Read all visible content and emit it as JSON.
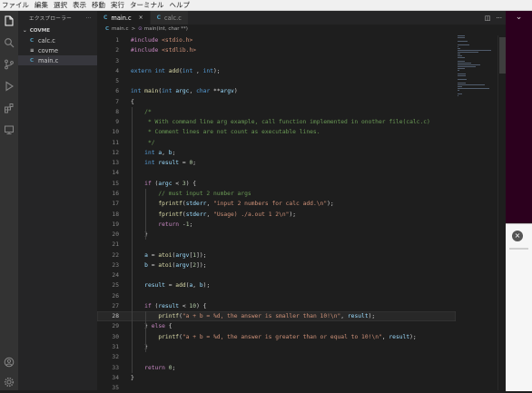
{
  "menubar": {
    "items": [
      "ファイル",
      "編集",
      "選択",
      "表示",
      "移動",
      "実行",
      "ターミナル",
      "ヘルプ"
    ]
  },
  "activity_bar": {
    "icons": [
      "files-icon",
      "search-icon",
      "source-control-icon",
      "run-debug-icon",
      "extensions-icon",
      "remote-explorer-icon",
      "account-icon",
      "settings-gear-icon"
    ]
  },
  "sidebar": {
    "title": "エクスプローラー",
    "more": "···",
    "folder": "COVME",
    "files": [
      {
        "icon": "C",
        "name": "calc.c"
      },
      {
        "icon": "≡",
        "name": "covme"
      },
      {
        "icon": "C",
        "name": "main.c"
      }
    ],
    "selected_index": 2
  },
  "tabs": [
    {
      "icon": "C",
      "label": "main.c",
      "close": "×",
      "active": true
    },
    {
      "icon": "C",
      "label": "calc.c",
      "close": "",
      "active": false
    }
  ],
  "tab_actions": {
    "split": "◫",
    "more": "···"
  },
  "breadcrumb": {
    "file_icon": "C",
    "file": "main.c",
    "sep": ">",
    "symbol_icon": "⊙",
    "symbol": "main(int, char **)"
  },
  "editor": {
    "current_line": 28,
    "lines": [
      [
        [
          "pp",
          "#include "
        ],
        [
          "inc",
          "<stdio.h>"
        ]
      ],
      [
        [
          "pp",
          "#include "
        ],
        [
          "inc",
          "<stdlib.h>"
        ]
      ],
      [],
      [
        [
          "kw",
          "extern "
        ],
        [
          "kw",
          "int "
        ],
        [
          "fn",
          "add"
        ],
        [
          "",
          "("
        ],
        [
          "kw",
          "int"
        ],
        [
          "",
          " , "
        ],
        [
          "kw",
          "int"
        ],
        [
          "",
          "); "
        ]
      ],
      [],
      [
        [
          "kw",
          "int "
        ],
        [
          "fn",
          "main"
        ],
        [
          "",
          "("
        ],
        [
          "kw",
          "int "
        ],
        [
          "var",
          "argc"
        ],
        [
          "",
          ", "
        ],
        [
          "kw",
          "char "
        ],
        [
          "",
          "**"
        ],
        [
          "var",
          "argv"
        ],
        [
          "",
          ")"
        ]
      ],
      [
        [
          "",
          "{"
        ]
      ],
      [
        [
          "",
          "    "
        ],
        [
          "cm",
          "/*"
        ]
      ],
      [
        [
          "",
          "    "
        ],
        [
          "cm",
          " * With command line arg example, call function implemented in onother file(calc.c)"
        ]
      ],
      [
        [
          "",
          "    "
        ],
        [
          "cm",
          " * Comment lines are not count as executable lines."
        ]
      ],
      [
        [
          "",
          "    "
        ],
        [
          "cm",
          " */"
        ]
      ],
      [
        [
          "",
          "    "
        ],
        [
          "kw",
          "int "
        ],
        [
          "var",
          "a"
        ],
        [
          "",
          ", "
        ],
        [
          "var",
          "b"
        ],
        [
          "",
          ";"
        ]
      ],
      [
        [
          "",
          "    "
        ],
        [
          "kw",
          "int "
        ],
        [
          "var",
          "result"
        ],
        [
          "",
          " = "
        ],
        [
          "num2",
          "0"
        ],
        [
          "",
          ";"
        ]
      ],
      [],
      [
        [
          "",
          "    "
        ],
        [
          "pp",
          "if "
        ],
        [
          "",
          "("
        ],
        [
          "var",
          "argc"
        ],
        [
          "",
          " < "
        ],
        [
          "num2",
          "3"
        ],
        [
          "",
          ") {"
        ]
      ],
      [
        [
          "",
          "        "
        ],
        [
          "cm",
          "// must input 2 number args"
        ]
      ],
      [
        [
          "",
          "        "
        ],
        [
          "fn",
          "fprintf"
        ],
        [
          "",
          "("
        ],
        [
          "var",
          "stderr"
        ],
        [
          "",
          ", "
        ],
        [
          "str",
          "\"input 2 numbers for calc add.\\n\""
        ],
        [
          "",
          ");"
        ]
      ],
      [
        [
          "",
          "        "
        ],
        [
          "fn",
          "fprintf"
        ],
        [
          "",
          "("
        ],
        [
          "var",
          "stderr"
        ],
        [
          "",
          ", "
        ],
        [
          "str",
          "\"Usage) ./a.out 1 2\\n\""
        ],
        [
          "",
          ");"
        ]
      ],
      [
        [
          "",
          "        "
        ],
        [
          "pp",
          "return "
        ],
        [
          "",
          "-"
        ],
        [
          "num2",
          "1"
        ],
        [
          "",
          ";"
        ]
      ],
      [
        [
          "",
          "    "
        ],
        [
          "",
          "}"
        ]
      ],
      [],
      [
        [
          "",
          "    "
        ],
        [
          "var",
          "a"
        ],
        [
          "",
          " = "
        ],
        [
          "fn",
          "atoi"
        ],
        [
          "",
          "("
        ],
        [
          "var",
          "argv"
        ],
        [
          "",
          "["
        ],
        [
          "num2",
          "1"
        ],
        [
          "",
          "]);"
        ]
      ],
      [
        [
          "",
          "    "
        ],
        [
          "var",
          "b"
        ],
        [
          "",
          " = "
        ],
        [
          "fn",
          "atoi"
        ],
        [
          "",
          "("
        ],
        [
          "var",
          "argv"
        ],
        [
          "",
          "["
        ],
        [
          "num2",
          "2"
        ],
        [
          "",
          "]);"
        ]
      ],
      [],
      [
        [
          "",
          "    "
        ],
        [
          "var",
          "result"
        ],
        [
          "",
          " = "
        ],
        [
          "fn",
          "add"
        ],
        [
          "",
          "("
        ],
        [
          "var",
          "a"
        ],
        [
          "",
          ", "
        ],
        [
          "var",
          "b"
        ],
        [
          "",
          ");"
        ]
      ],
      [],
      [
        [
          "",
          "    "
        ],
        [
          "pp",
          "if "
        ],
        [
          "",
          "("
        ],
        [
          "var",
          "result"
        ],
        [
          "",
          " < "
        ],
        [
          "num2",
          "10"
        ],
        [
          "",
          ") {"
        ]
      ],
      [
        [
          "",
          "        "
        ],
        [
          "fn",
          "printf"
        ],
        [
          "",
          "("
        ],
        [
          "str",
          "\"a + b = %d, the answer is smaller than 10!\\n\""
        ],
        [
          "",
          ", "
        ],
        [
          "var",
          "result"
        ],
        [
          "",
          ");"
        ]
      ],
      [
        [
          "",
          "    "
        ],
        [
          "",
          "} "
        ],
        [
          "pp",
          "else "
        ],
        [
          "",
          "{"
        ]
      ],
      [
        [
          "",
          "        "
        ],
        [
          "fn",
          "printf"
        ],
        [
          "",
          "("
        ],
        [
          "str",
          "\"a + b = %d, the answer is greater than or equal to 10!\\n\""
        ],
        [
          "",
          ", "
        ],
        [
          "var",
          "result"
        ],
        [
          "",
          ");"
        ]
      ],
      [
        [
          "",
          "    "
        ],
        [
          "",
          "}"
        ]
      ],
      [],
      [
        [
          "",
          "    "
        ],
        [
          "pp",
          "return "
        ],
        [
          "num2",
          "0"
        ],
        [
          "",
          ";"
        ]
      ],
      [
        [
          "",
          "}"
        ]
      ],
      []
    ]
  },
  "right_area": {
    "top_control": "⌄",
    "panel_close": "×"
  },
  "colors": {
    "accent": "#007acc",
    "keyword": "#569cd6",
    "string": "#ce9178",
    "comment": "#6a9955",
    "function": "#dcdcaa",
    "variable": "#9cdcfe",
    "background": "#1e1e1e",
    "sidebar": "#252526"
  }
}
